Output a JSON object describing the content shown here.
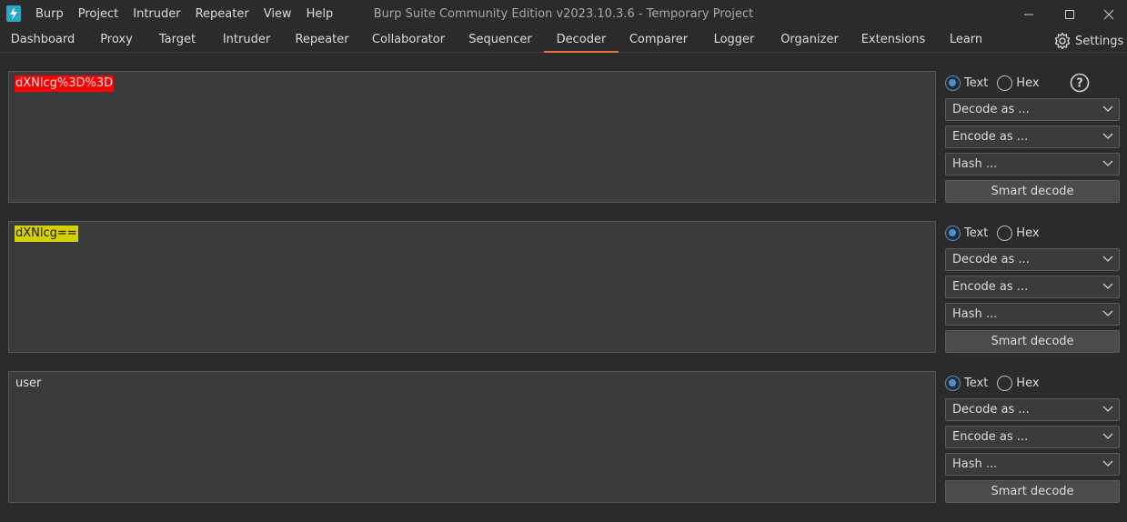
{
  "window": {
    "title": "Burp Suite Community Edition v2023.10.3.6 - Temporary Project"
  },
  "menu": [
    "Burp",
    "Project",
    "Intruder",
    "Repeater",
    "View",
    "Help"
  ],
  "tabs": [
    {
      "label": "Dashboard"
    },
    {
      "label": "Proxy"
    },
    {
      "label": "Target"
    },
    {
      "label": "Intruder"
    },
    {
      "label": "Repeater"
    },
    {
      "label": "Collaborator"
    },
    {
      "label": "Sequencer"
    },
    {
      "label": "Decoder",
      "active": true
    },
    {
      "label": "Comparer"
    },
    {
      "label": "Logger"
    },
    {
      "label": "Organizer"
    },
    {
      "label": "Extensions"
    },
    {
      "label": "Learn"
    }
  ],
  "settings_label": "Settings",
  "panels": [
    {
      "content": "dXNlcg%3D%3D",
      "text_label": "Text",
      "hex_label": "Hex",
      "selected_mode": "Text",
      "decode_label": "Decode as ...",
      "encode_label": "Encode as ...",
      "hash_label": "Hash ...",
      "smart_decode_label": "Smart decode"
    },
    {
      "content": "dXNlcg==",
      "text_label": "Text",
      "hex_label": "Hex",
      "selected_mode": "Text",
      "decode_label": "Decode as ...",
      "encode_label": "Encode as ...",
      "hash_label": "Hash ...",
      "smart_decode_label": "Smart decode"
    },
    {
      "content": "user",
      "text_label": "Text",
      "hex_label": "Hex",
      "selected_mode": "Text",
      "decode_label": "Decode as ...",
      "encode_label": "Encode as ...",
      "hash_label": "Hash ...",
      "smart_decode_label": "Smart decode"
    }
  ],
  "colors": {
    "accent_tab": "#e8733b",
    "radio_selected": "#4a90d9",
    "highlight_url_encoded": "#ff0000",
    "highlight_base64": "#d4d000",
    "logo": "#26a9c6"
  }
}
